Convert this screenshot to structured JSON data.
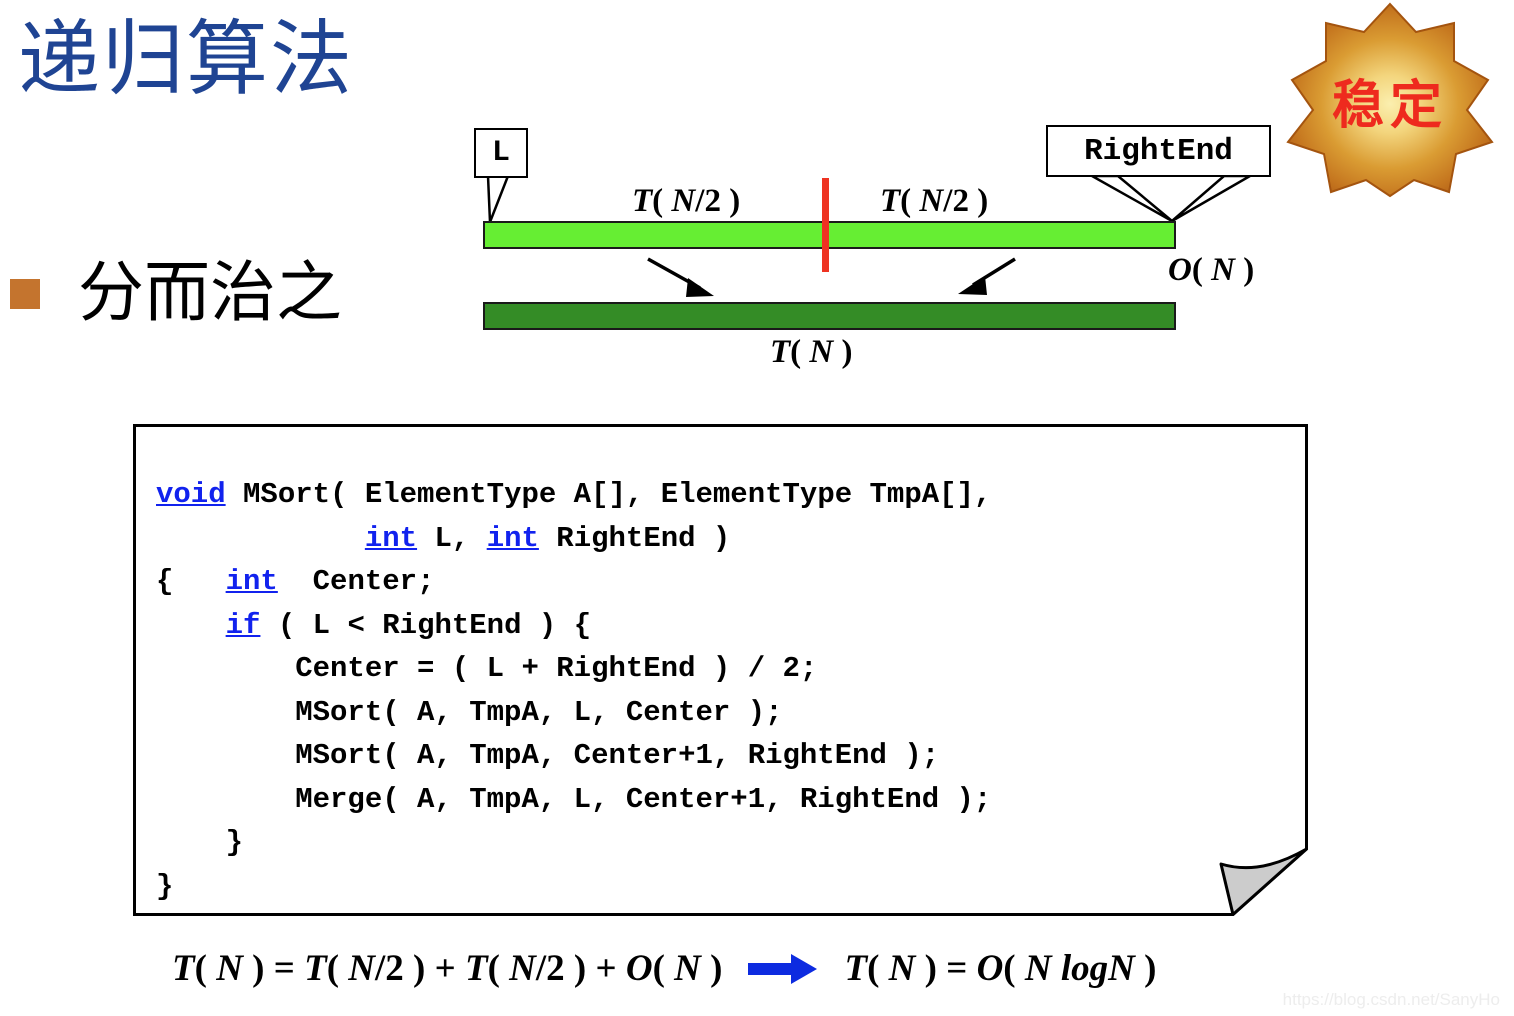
{
  "slide": {
    "title": "递归算法",
    "title_color": "#1F4493",
    "background": "#ffffff"
  },
  "bullet": {
    "marker_color": "#C4742E",
    "text": "分而治之"
  },
  "badge": {
    "label": "稳定",
    "text_color": "#EE2A1E",
    "fill_center": "#F5D77A",
    "fill_mid": "#D9952F",
    "fill_edge": "#C06A1E",
    "shape": "8-point-starburst"
  },
  "diagram": {
    "callout_left": {
      "label": "L"
    },
    "callout_right": {
      "label": "RightEnd"
    },
    "bar_top": {
      "color": "#66EE33",
      "border": "#1a1a1a"
    },
    "bar_bottom": {
      "color": "#348C26",
      "border": "#1a1a1a"
    },
    "split_line_color": "#EE3322",
    "labels": {
      "left_half": "T( N/2 )",
      "right_half": "T( N/2 )",
      "merge_cost": "O( N )",
      "total": "T( N )"
    },
    "arrow_color": "#000000"
  },
  "code": {
    "keyword_color": "#1122EE",
    "text_color": "#000000",
    "border_color": "#000000",
    "curl_fill": "#CCCCCC",
    "lines": [
      {
        "segments": [
          {
            "t": "void",
            "kw": true
          },
          {
            "t": " MSort( ElementType A[], ElementType TmpA[],",
            "kw": false
          }
        ]
      },
      {
        "segments": [
          {
            "t": "            ",
            "kw": false
          },
          {
            "t": "int",
            "kw": true
          },
          {
            "t": " L, ",
            "kw": false
          },
          {
            "t": "int",
            "kw": true
          },
          {
            "t": " RightEnd )",
            "kw": false
          }
        ]
      },
      {
        "segments": [
          {
            "t": "{   ",
            "kw": false
          },
          {
            "t": "int",
            "kw": true
          },
          {
            "t": "  Center;",
            "kw": false
          }
        ]
      },
      {
        "segments": [
          {
            "t": "    ",
            "kw": false
          },
          {
            "t": "if",
            "kw": true
          },
          {
            "t": " ( L < RightEnd ) {",
            "kw": false
          }
        ]
      },
      {
        "segments": [
          {
            "t": "        Center = ( L + RightEnd ) / 2;",
            "kw": false
          }
        ]
      },
      {
        "segments": [
          {
            "t": "        MSort( A, TmpA, L, Center );",
            "kw": false
          }
        ]
      },
      {
        "segments": [
          {
            "t": "        MSort( A, TmpA, Center+1, RightEnd );",
            "kw": false
          }
        ]
      },
      {
        "segments": [
          {
            "t": "        Merge( A, TmpA, L, Center+1, RightEnd );",
            "kw": false
          }
        ]
      },
      {
        "segments": [
          {
            "t": "    }",
            "kw": false
          }
        ]
      },
      {
        "segments": [
          {
            "t": "}",
            "kw": false
          }
        ]
      }
    ]
  },
  "formula": {
    "left": "T( N ) = T( N/2 ) + T( N/2 ) + O( N )",
    "arrow_color": "#0D2BE0",
    "right": "T( N ) = O( N logN )"
  },
  "watermark": {
    "text": "https://blog.csdn.net/SanyHo"
  }
}
